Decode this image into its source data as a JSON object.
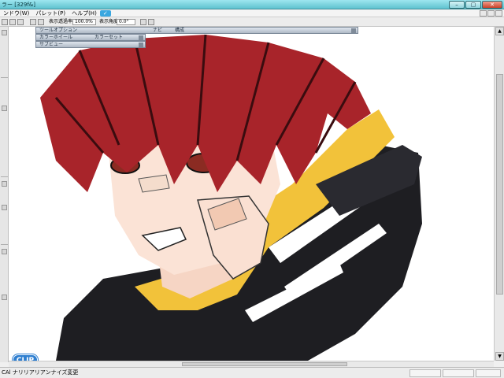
{
  "window": {
    "title": "ラー [329f&]",
    "controls": [
      "–",
      "▢",
      "✕"
    ]
  },
  "menu": {
    "items": [
      "ンドウ(W)",
      "パレット(P)",
      "ヘルプ(H)"
    ],
    "badge": "✓"
  },
  "toolbar": {
    "opacity_label": "表示透過率",
    "opacity_value": "100.0%",
    "angle_label": "表示角度",
    "angle_value": "0.0°"
  },
  "palettes": [
    {
      "tabs": [
        "ツールオプション",
        "ナビ",
        "構成"
      ]
    },
    {
      "tabs": [
        "カラーホイール",
        "カラーセット"
      ]
    },
    {
      "tabs": [
        "サブビュー"
      ]
    }
  ],
  "logo": {
    "text": "CLIP"
  },
  "status": {
    "text": "CAl ナリリアリアンナイズ変更"
  },
  "colors": {
    "titlebar": "#5fc2cf",
    "hair": "#a8242a",
    "skin": "#fbe3d6",
    "scarf": "#f2c23a",
    "jacket": "#1e1e22"
  }
}
